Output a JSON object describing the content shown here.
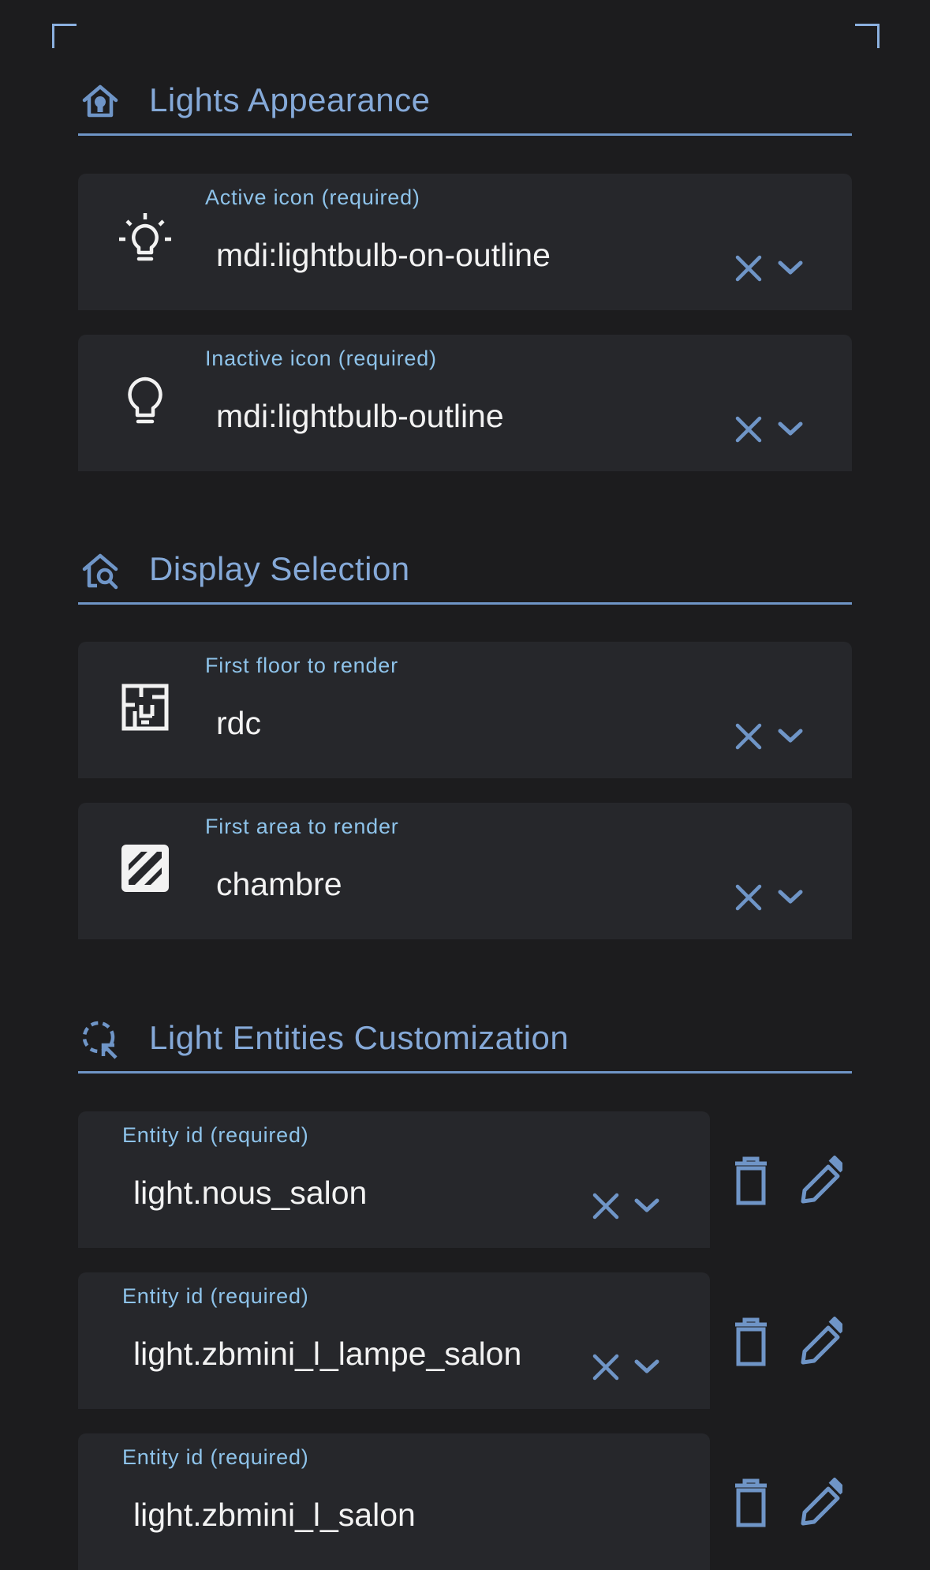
{
  "sections": {
    "lights_appearance": {
      "title": "Lights Appearance",
      "icon": "home-lightbulb-icon"
    },
    "display_selection": {
      "title": "Display Selection",
      "icon": "home-search-icon"
    },
    "light_entities": {
      "title": "Light Entities Customization",
      "icon": "selection-ellipse-arrow-icon"
    }
  },
  "fields": {
    "active_icon": {
      "label": "Active icon (required)",
      "value": "mdi:lightbulb-on-outline",
      "icon": "lightbulb-on-outline-icon"
    },
    "inactive_icon": {
      "label": "Inactive icon (required)",
      "value": "mdi:lightbulb-outline",
      "icon": "lightbulb-outline-icon"
    },
    "first_floor": {
      "label": "First floor to render",
      "value": "rdc",
      "icon": "floor-plan-icon"
    },
    "first_area": {
      "label": "First area to render",
      "value": "chambre",
      "icon": "texture-box-icon"
    }
  },
  "entities": [
    {
      "label": "Entity id (required)",
      "value": "light.nous_salon"
    },
    {
      "label": "Entity id (required)",
      "value": "light.zbmini_l_lampe_salon"
    },
    {
      "label": "Entity id (required)",
      "value": "light.zbmini_l_salon"
    }
  ],
  "icons": {
    "clear": "close-icon",
    "dropdown": "chevron-down-icon",
    "delete": "trash-can-icon",
    "edit": "pencil-icon"
  },
  "colors": {
    "background": "#1c1c1e",
    "field_background": "#26272b",
    "accent": "#85a9d8",
    "label": "#8ec3ea",
    "icon_button": "#6f95c7",
    "text": "#f2f2f2"
  }
}
